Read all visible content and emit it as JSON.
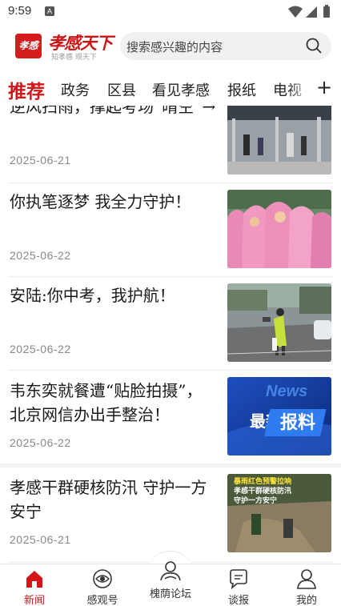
{
  "status": {
    "time": "9:59",
    "notif": "A"
  },
  "header": {
    "logo_mark": "孝感",
    "logo_text": "孝感天下",
    "logo_sub": "知孝感 观天下",
    "search_placeholder": "搜索感兴趣的内容"
  },
  "tabs": [
    "推荐",
    "政务",
    "区县",
    "看见孝感",
    "报纸",
    "电视"
  ],
  "feed": [
    {
      "title": "逆风扫雨，撑起考场“晴空”→",
      "date": "2025-06-21",
      "thumb": "gate-scene"
    },
    {
      "title": "你执笔逐梦  我全力守护！",
      "date": "2025-06-22",
      "thumb": "raincoats-scene"
    },
    {
      "title": "安陆:你中考，我护航！",
      "date": "2025-06-22",
      "thumb": "police-scene"
    },
    {
      "title": "韦东奕就餐遭“贴脸拍摄”，北京网信办出手整治！",
      "date": "2025-06-22",
      "thumb": "news-scene"
    },
    {
      "title": "孝感干群硬核防汛  守护一方安宁",
      "date": "2025-06-21",
      "thumb": "flood-scene"
    }
  ],
  "thumb_text": {
    "news_en": "News",
    "news_cn1": "最新",
    "news_cn2": "报料",
    "flood_line1": "暴雨红色预警拉响",
    "flood_line2": "孝感干群硬核防汛",
    "flood_line3": "守护一方安宁"
  },
  "bottom_nav": [
    {
      "label": "新闻",
      "icon": "home-icon",
      "active": true
    },
    {
      "label": "感观号",
      "icon": "eye-icon",
      "active": false
    },
    {
      "label": "槐荫论坛",
      "icon": "forum-icon",
      "active": false
    },
    {
      "label": "谈报",
      "icon": "chat-icon",
      "active": false
    },
    {
      "label": "我的",
      "icon": "profile-icon",
      "active": false
    }
  ],
  "colors": {
    "accent": "#d4161b",
    "brand": "#cc1414"
  }
}
